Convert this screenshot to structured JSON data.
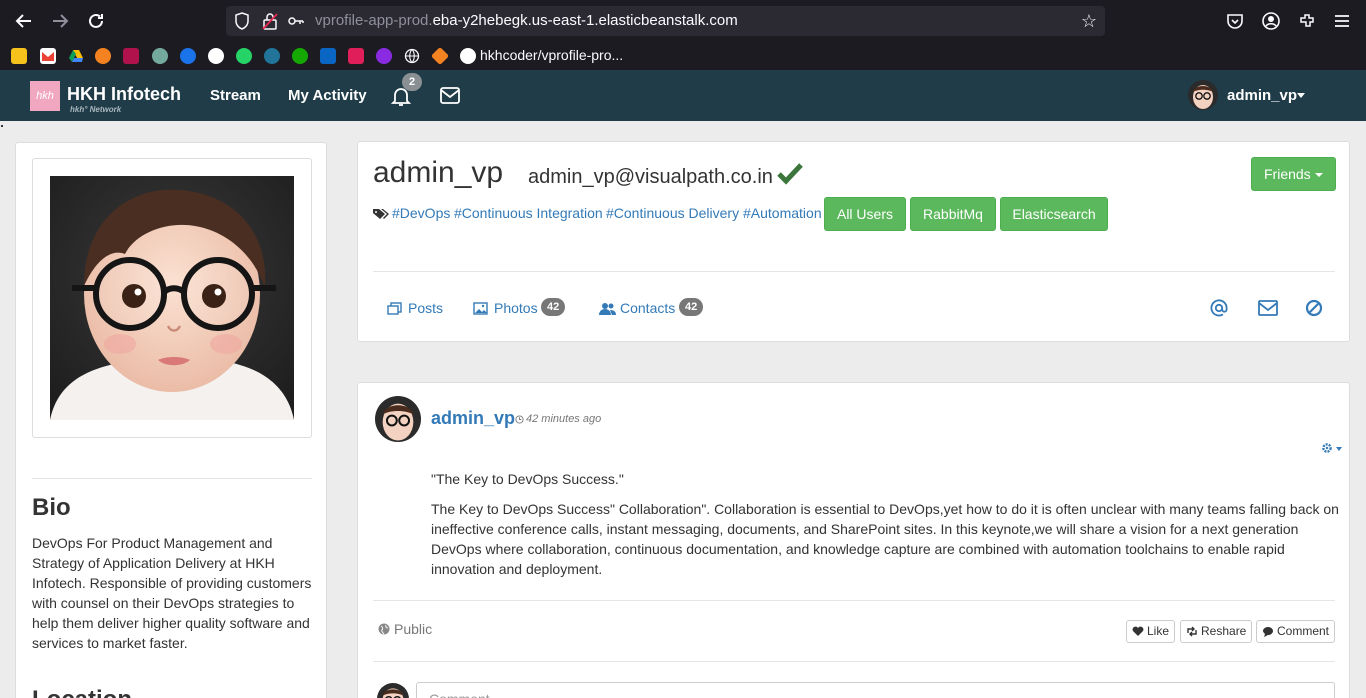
{
  "browser": {
    "url_dim": "vprofile-app-prod.",
    "url_main": "eba-y2hebegk.us-east-1.elasticbeanstalk.com",
    "bookmark_label": "hkhcoder/vprofile-pro..."
  },
  "navbar": {
    "logo_text": "hkh",
    "brand": "HKH Infotech",
    "brand_sub": "hkh° Network",
    "links": [
      "Stream",
      "My Activity"
    ],
    "notification_count": "2",
    "user": "admin_vp"
  },
  "profile": {
    "name": "admin_vp",
    "email": "admin_vp@visualpath.co.in",
    "friends_label": "Friends",
    "tags": [
      "#DevOps",
      "#Continuous Integration",
      "#Continuous Delivery",
      "#Automation"
    ],
    "buttons": [
      "All Users",
      "RabbitMq",
      "Elasticsearch"
    ],
    "tabs": {
      "posts": "Posts",
      "photos": "Photos",
      "photos_count": "42",
      "contacts": "Contacts",
      "contacts_count": "42"
    }
  },
  "sidebar": {
    "bio_heading": "Bio",
    "bio_text": "DevOps For Product Management and Strategy of Application Delivery at HKH Infotech. Responsible of providing customers with counsel on their DevOps strategies to help them deliver higher quality software and services to market faster.",
    "location_heading": "Location"
  },
  "post": {
    "author": "admin_vp",
    "time": "42 minutes ago",
    "title": "\"The Key to DevOps Success.\"",
    "body": "The Key to DevOps Success\" Collaboration\". Collaboration is essential to DevOps,yet how to do it is often unclear with many teams falling back on ineffective conference calls, instant messaging, documents, and SharePoint sites. In this keynote,we will share a vision for a next generation DevOps where collaboration, continuous documentation, and knowledge capture are combined with automation toolchains to enable rapid innovation and deployment.",
    "visibility": "Public",
    "like": "Like",
    "reshare": "Reshare",
    "comment": "Comment",
    "comment_placeholder": "Comment"
  },
  "colors": {
    "navbar": "#1f3c48",
    "link": "#337ab7",
    "success": "#5cb85c"
  }
}
